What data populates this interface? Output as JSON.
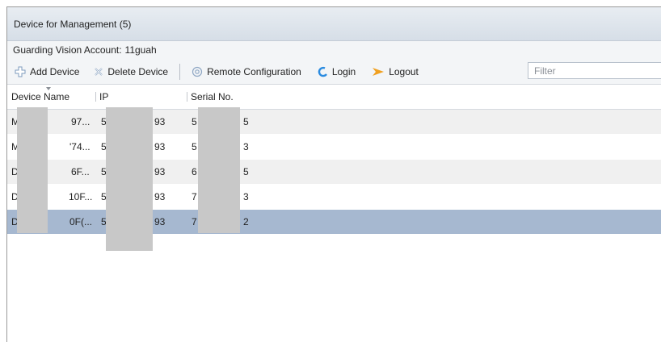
{
  "panel": {
    "title": "Device for Management (5)"
  },
  "account": {
    "label": "Guarding Vision Account:",
    "value": "11guah"
  },
  "toolbar": {
    "add_device": "Add Device",
    "delete_device": "Delete Device",
    "remote_configuration": "Remote Configuration",
    "login": "Login",
    "logout": "Logout",
    "filter_placeholder": "Filter"
  },
  "table": {
    "columns": [
      "Device Name",
      "IP",
      "Serial No."
    ],
    "rows": [
      {
        "name_a": "M",
        "name_b": "97...",
        "ip_a": "5",
        "ip_b": "93",
        "serial_a": "5",
        "serial_b": "5",
        "selected": false
      },
      {
        "name_a": "M",
        "name_b": "'74...",
        "ip_a": "5",
        "ip_b": "93",
        "serial_a": "5",
        "serial_b": "3",
        "selected": false
      },
      {
        "name_a": "D!",
        "name_b": "6F...",
        "ip_a": "5",
        "ip_b": "93",
        "serial_a": "6",
        "serial_b": "5",
        "selected": false
      },
      {
        "name_a": "D!",
        "name_b": "10F...",
        "ip_a": "5",
        "ip_b": "93",
        "serial_a": "7",
        "serial_b": "3",
        "selected": false
      },
      {
        "name_a": "D!",
        "name_b": "0F(...",
        "ip_a": "5",
        "ip_b": "93",
        "serial_a": "7",
        "serial_b": "2",
        "selected": true
      }
    ]
  },
  "colors": {
    "titlebar": "#dbe2ea",
    "selected_row": "#a6b8d0",
    "alt_row": "#f0f0f0",
    "login_icon": "#2a8be0",
    "logout_icon": "#f0a020"
  },
  "icons": {
    "add": "plus-outline-icon",
    "delete": "x-outline-icon",
    "remote": "gear-circle-icon",
    "login": "refresh-arc-icon",
    "logout": "arrow-flag-icon"
  }
}
